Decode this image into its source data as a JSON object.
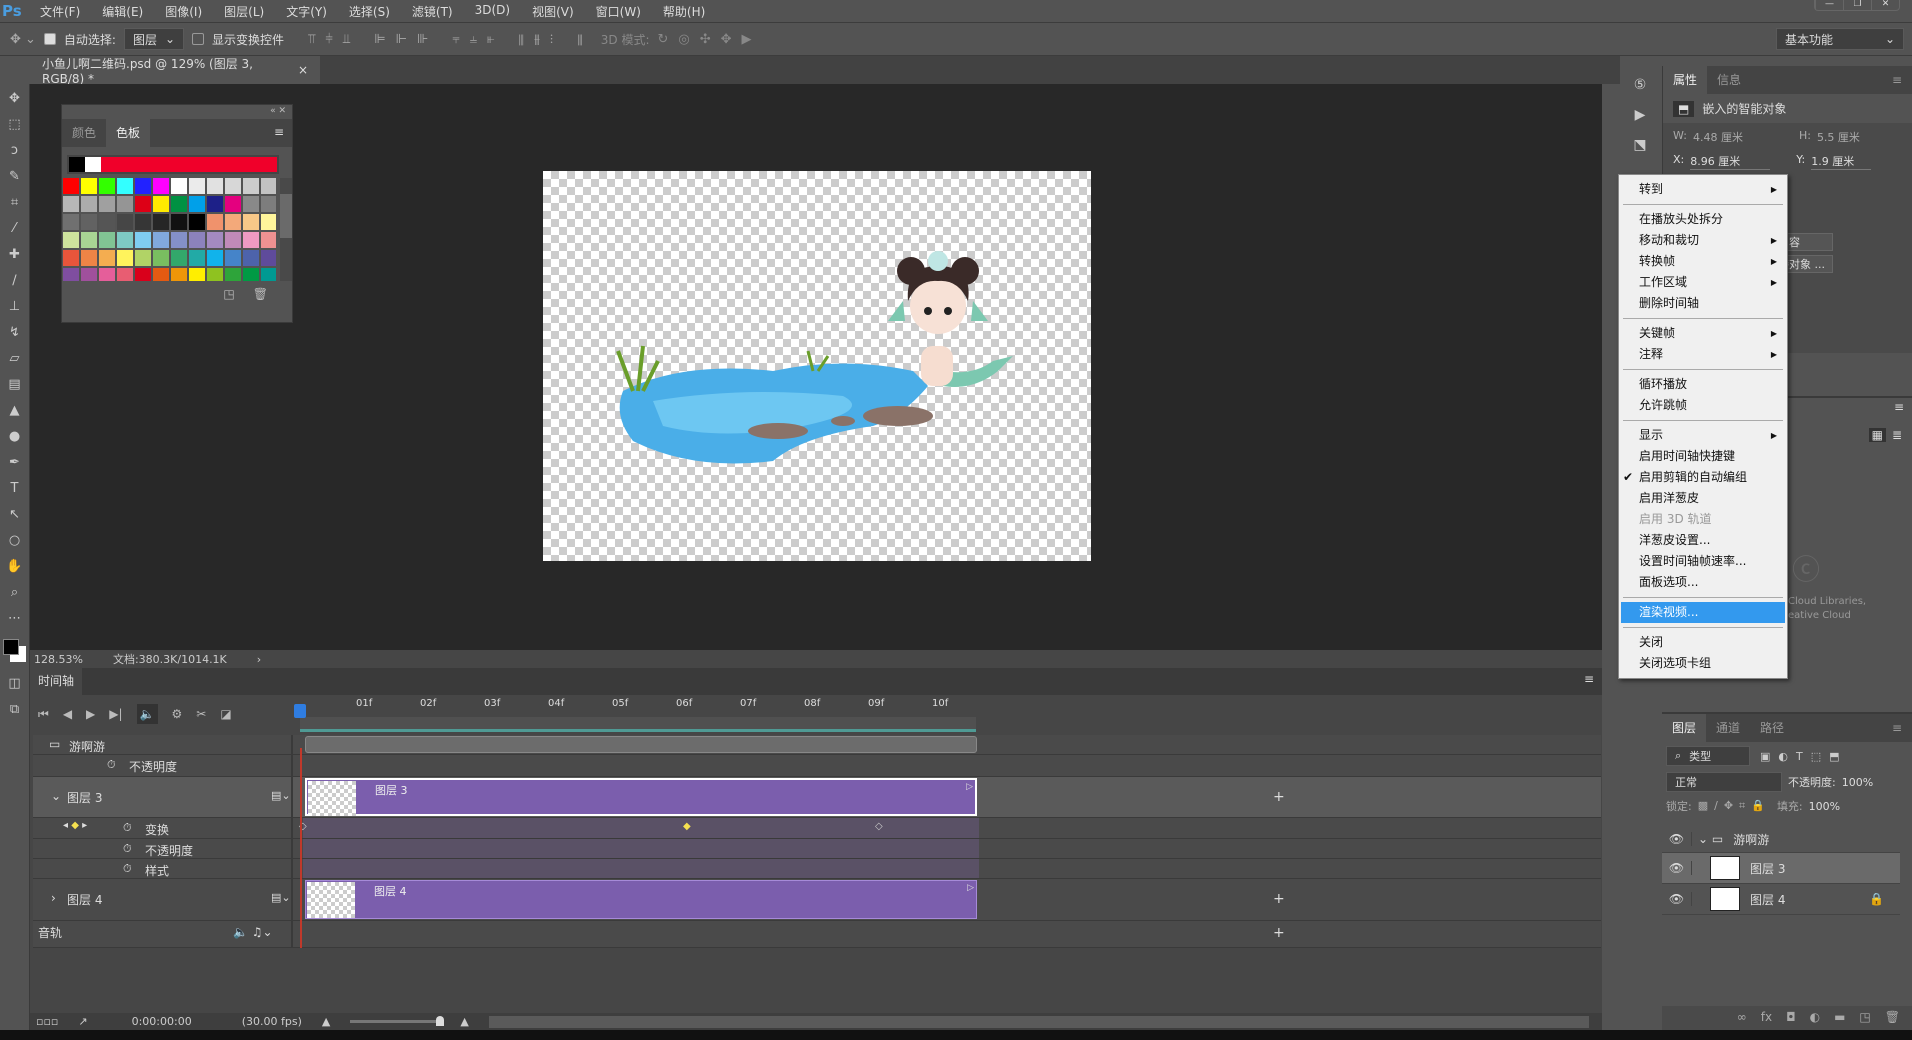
{
  "app": {
    "logo": "Ps",
    "menu": [
      "文件(F)",
      "编辑(E)",
      "图像(I)",
      "图层(L)",
      "文字(Y)",
      "选择(S)",
      "滤镜(T)",
      "3D(D)",
      "视图(V)",
      "窗口(W)",
      "帮助(H)"
    ]
  },
  "options": {
    "auto_select_label": "自动选择:",
    "auto_select_checked": true,
    "auto_select_value": "图层",
    "show_transform_label": "显示变换控件",
    "show_transform_checked": false,
    "mode3d_label": "3D 模式:",
    "workspace": "基本功能"
  },
  "document": {
    "tab_title": "小鱼儿啊二维码.psd @ 129% (图层 3, RGB/8) *",
    "zoom": "128.53%",
    "doc_size": "文档:380.3K/1014.1K"
  },
  "swatches": {
    "tabs": [
      "颜色",
      "色板"
    ],
    "active": "色板",
    "recent": [
      "#000000",
      "#ffffff",
      "#f0002a",
      "#f0002a",
      "#f0002a",
      "#f0002a",
      "#f0002a",
      "#f0002a",
      "#f0002a",
      "#f0002a",
      "#f0002a",
      "#f0002a",
      "#f0002a"
    ],
    "colors": [
      "#ff0000",
      "#ffff00",
      "#33ff00",
      "#33ffff",
      "#2222ff",
      "#ff00ff",
      "#ffffff",
      "#ebebeb",
      "#e1e1e1",
      "#d7d7d7",
      "#cccccc",
      "#c2c2c2",
      "#b7b7b7",
      "#acacac",
      "#a0a0a0",
      "#959595",
      "#dd0016",
      "#ffea00",
      "#009142",
      "#00a0e9",
      "#1d2088",
      "#e4007f",
      "#898989",
      "#7d7d7d",
      "#707070",
      "#626262",
      "#555555",
      "#464646",
      "#363636",
      "#262626",
      "#111111",
      "#000000",
      "#f0926c",
      "#f3a97a",
      "#f8c888",
      "#fff59b",
      "#cde39d",
      "#a9d594",
      "#81c494",
      "#7ecac4",
      "#7fcdf2",
      "#81a9dc",
      "#8490c8",
      "#8c82bc",
      "#a38ac0",
      "#c08ab9",
      "#ee9ac3",
      "#ef9191",
      "#e8553b",
      "#ee8446",
      "#f4ad50",
      "#fff35c",
      "#b1d366",
      "#79be60",
      "#33a86b",
      "#22aaa6",
      "#11b3eb",
      "#4584c9",
      "#4d63ab",
      "#5f4b9b",
      "#7f4ea0",
      "#a0509c",
      "#e55e9a",
      "#e85d72",
      "#d9001b",
      "#e45a12",
      "#ef9608",
      "#ffee00",
      "#8fc220",
      "#2ea43a",
      "#009a44",
      "#009a92",
      "#0098d9",
      "#0062b0",
      "#073e8f",
      "#1d217e",
      "#5b1683",
      "#901071",
      "#e2007e",
      "#d8004f",
      "#a0000b",
      "#a43b02",
      "#a66400",
      "#b6a800"
    ]
  },
  "properties": {
    "tabs": [
      "属性",
      "信息"
    ],
    "active": "属性",
    "type": "嵌入的智能对象",
    "w_label": "W:",
    "w": "4.48 厘米",
    "h_label": "H:",
    "h": "5.5 厘米",
    "x_label": "X:",
    "x": "8.96 厘米",
    "y_label": "Y:",
    "y": "1.9 厘米",
    "btn1": "内容",
    "btn2": "接对象 ...",
    "libs_text1": "Cloud Libraries,",
    "libs_text2": "eative Cloud"
  },
  "context_menu": [
    {
      "label": "转到",
      "submenu": true
    },
    {
      "sep": true
    },
    {
      "label": "在播放头处拆分"
    },
    {
      "label": "移动和裁切",
      "submenu": true
    },
    {
      "label": "转换帧",
      "submenu": true
    },
    {
      "label": "工作区域",
      "submenu": true
    },
    {
      "label": "删除时间轴"
    },
    {
      "sep": true
    },
    {
      "label": "关键帧",
      "submenu": true
    },
    {
      "label": "注释",
      "submenu": true
    },
    {
      "sep": true
    },
    {
      "label": "循环播放"
    },
    {
      "label": "允许跳帧"
    },
    {
      "sep": true
    },
    {
      "label": "显示",
      "submenu": true
    },
    {
      "label": "启用时间轴快捷键"
    },
    {
      "label": "启用剪辑的自动编组",
      "checked": true
    },
    {
      "label": "启用洋葱皮"
    },
    {
      "label": "启用 3D 轨道",
      "disabled": true
    },
    {
      "label": "洋葱皮设置..."
    },
    {
      "label": "设置时间轴帧速率..."
    },
    {
      "label": "面板选项..."
    },
    {
      "sep": true
    },
    {
      "label": "渲染视频...",
      "highlighted": true
    },
    {
      "sep": true
    },
    {
      "label": "关闭"
    },
    {
      "label": "关闭选项卡组"
    }
  ],
  "layers": {
    "tabs": [
      "图层",
      "通道",
      "路径"
    ],
    "active": "图层",
    "filter": "类型",
    "blend": "正常",
    "opacity_label": "不透明度:",
    "opacity": "100%",
    "lock_label": "锁定:",
    "fill_label": "填充:",
    "fill": "100%",
    "items": [
      {
        "name": "游啊游",
        "type": "group"
      },
      {
        "name": "图层 3",
        "selected": true
      },
      {
        "name": "图层 4",
        "locked": true
      }
    ]
  },
  "timeline": {
    "title": "时间轴",
    "ruler": [
      "01f",
      "02f",
      "03f",
      "04f",
      "05f",
      "06f",
      "07f",
      "08f",
      "09f",
      "10f"
    ],
    "group": "游啊游",
    "group_opacity": "不透明度",
    "layer3": "图层 3",
    "transform": "变换",
    "opacity": "不透明度",
    "style": "样式",
    "layer4": "图层 4",
    "audio": "音轨",
    "keyframes_frames": [
      0,
      6,
      9
    ],
    "timecode": "0:00:00:00",
    "fps": "(30.00 fps)",
    "clip_color": "#7b5ead"
  }
}
